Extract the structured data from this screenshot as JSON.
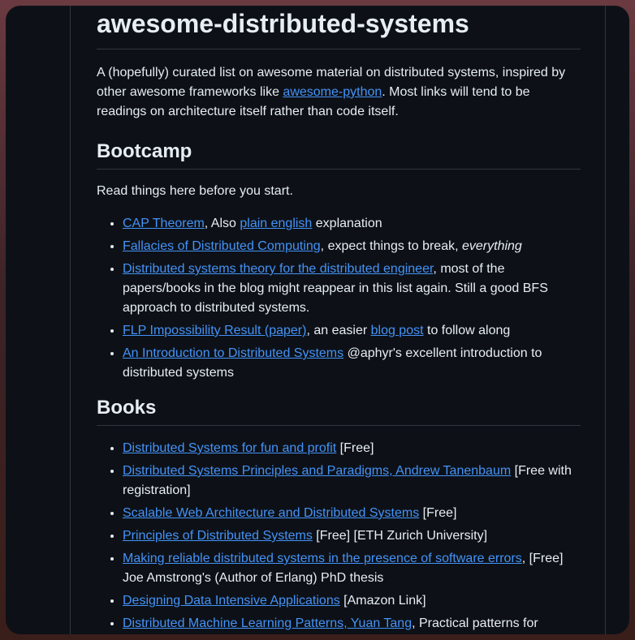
{
  "title": "awesome-distributed-systems",
  "intro": {
    "pre": "A (hopefully) curated list on awesome material on distributed systems, inspired by other awesome frameworks like ",
    "link": "awesome-python",
    "post": ". Most links will tend to be readings on architecture itself rather than code itself."
  },
  "bootcamp": {
    "heading": "Bootcamp",
    "lead": "Read things here before you start.",
    "items": [
      {
        "link1": "CAP Theorem",
        "t1": ", Also ",
        "link2": "plain english",
        "t2": " explanation"
      },
      {
        "link1": "Fallacies of Distributed Computing",
        "t1": ", expect things to break, ",
        "em": "everything"
      },
      {
        "link1": "Distributed systems theory for the distributed engineer",
        "t1": ", most of the papers/books in the blog might reappear in this list again. Still a good BFS approach to distributed systems."
      },
      {
        "link1": "FLP Impossibility Result (paper)",
        "t1": ", an easier ",
        "link2": "blog post",
        "t2": " to follow along"
      },
      {
        "link1": "An Introduction to Distributed Systems",
        "t1": " @aphyr's excellent introduction to distributed systems"
      }
    ]
  },
  "books": {
    "heading": "Books",
    "items": [
      {
        "link": "Distributed Systems for fun and profit",
        "text": " [Free]"
      },
      {
        "link": "Distributed Systems Principles and Paradigms, Andrew Tanenbaum",
        "text": " [Free with registration]"
      },
      {
        "link": "Scalable Web Architecture and Distributed Systems",
        "text": " [Free]"
      },
      {
        "link": "Principles of Distributed Systems",
        "text": " [Free] [ETH Zurich University]"
      },
      {
        "link": "Making reliable distributed systems in the presence of software errors",
        "text": ", [Free] Joe Amstrong's (Author of Erlang) PhD thesis"
      },
      {
        "link": "Designing Data Intensive Applications",
        "text": " [Amazon Link]"
      },
      {
        "link": "Distributed Machine Learning Patterns, Yuan Tang",
        "text": ", Practical patterns for"
      }
    ]
  },
  "colors": {
    "background": "#0d1117",
    "text": "#e6edf3",
    "link": "#4493f8",
    "border": "#30363d"
  }
}
